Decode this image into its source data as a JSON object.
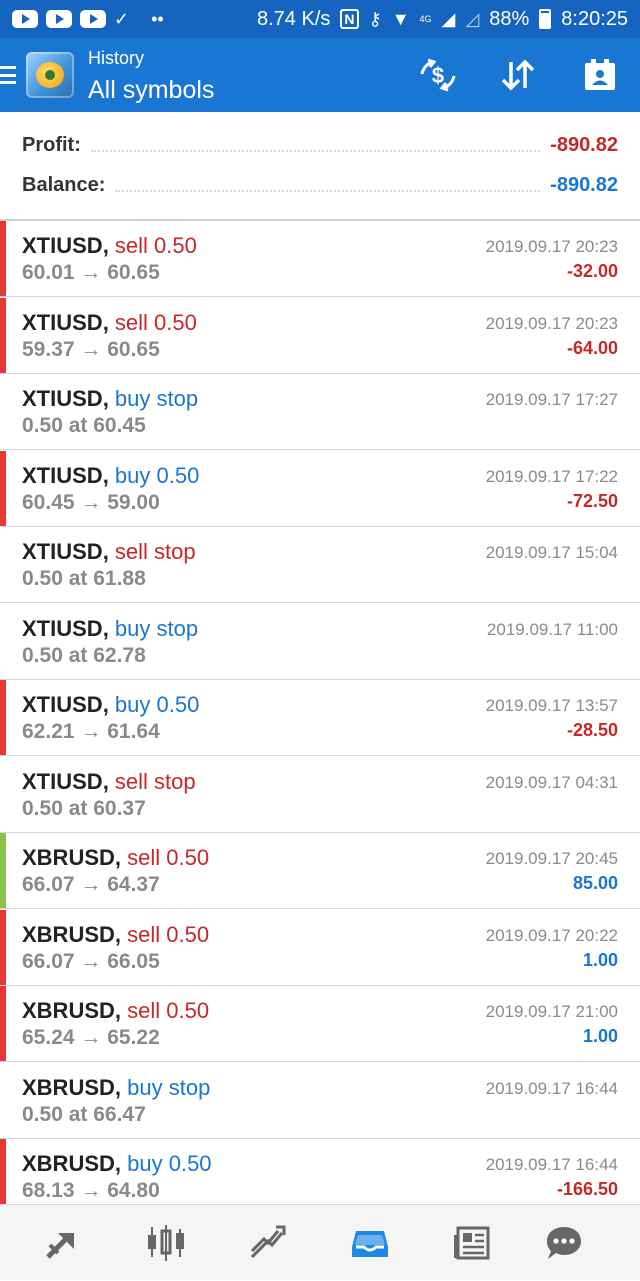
{
  "status_bar": {
    "network_speed": "8.74 K/s",
    "battery": "88%",
    "clock": "8:20:25",
    "signal_label": "4G"
  },
  "app_bar": {
    "subtitle": "History",
    "title": "All symbols"
  },
  "summary": {
    "profit_label": "Profit:",
    "profit_value": "-890.82",
    "balance_label": "Balance:",
    "balance_value": "-890.82"
  },
  "colors": {
    "accent": "#1976d2",
    "status_bar": "#1565c0",
    "loss": "#c62828",
    "gain": "#1976d2",
    "loss_bar": "#e53935",
    "gain_bar": "#8bc34a"
  },
  "trades": [
    {
      "symbol": "XTIUSD",
      "action": "sell 0.50",
      "action_type": "sell",
      "detail": "60.01 → 60.65",
      "time": "2019.09.17 20:23",
      "profit": "-32.00",
      "result": "loss"
    },
    {
      "symbol": "XTIUSD",
      "action": "sell 0.50",
      "action_type": "sell",
      "detail": "59.37 → 60.65",
      "time": "2019.09.17 20:23",
      "profit": "-64.00",
      "result": "loss"
    },
    {
      "symbol": "XTIUSD",
      "action": "buy stop",
      "action_type": "buy",
      "detail": "0.50 at 60.45",
      "time": "2019.09.17 17:27",
      "profit": "",
      "result": "none"
    },
    {
      "symbol": "XTIUSD",
      "action": "buy 0.50",
      "action_type": "buy",
      "detail": "60.45 → 59.00",
      "time": "2019.09.17 17:22",
      "profit": "-72.50",
      "result": "loss"
    },
    {
      "symbol": "XTIUSD",
      "action": "sell stop",
      "action_type": "sell",
      "detail": "0.50 at 61.88",
      "time": "2019.09.17 15:04",
      "profit": "",
      "result": "none"
    },
    {
      "symbol": "XTIUSD",
      "action": "buy stop",
      "action_type": "buy",
      "detail": "0.50 at 62.78",
      "time": "2019.09.17 11:00",
      "profit": "",
      "result": "none"
    },
    {
      "symbol": "XTIUSD",
      "action": "buy 0.50",
      "action_type": "buy",
      "detail": "62.21 → 61.64",
      "time": "2019.09.17 13:57",
      "profit": "-28.50",
      "result": "loss"
    },
    {
      "symbol": "XTIUSD",
      "action": "sell stop",
      "action_type": "sell",
      "detail": "0.50 at 60.37",
      "time": "2019.09.17 04:31",
      "profit": "",
      "result": "none"
    },
    {
      "symbol": "XBRUSD",
      "action": "sell 0.50",
      "action_type": "sell",
      "detail": "66.07 → 64.37",
      "time": "2019.09.17 20:45",
      "profit": "85.00",
      "result": "gain"
    },
    {
      "symbol": "XBRUSD",
      "action": "sell 0.50",
      "action_type": "sell",
      "detail": "66.07 → 66.05",
      "time": "2019.09.17 20:22",
      "profit": "1.00",
      "result": "small-gain"
    },
    {
      "symbol": "XBRUSD",
      "action": "sell 0.50",
      "action_type": "sell",
      "detail": "65.24 → 65.22",
      "time": "2019.09.17 21:00",
      "profit": "1.00",
      "result": "small-gain"
    },
    {
      "symbol": "XBRUSD",
      "action": "buy stop",
      "action_type": "buy",
      "detail": "0.50 at 66.47",
      "time": "2019.09.17 16:44",
      "profit": "",
      "result": "none"
    },
    {
      "symbol": "XBRUSD",
      "action": "buy 0.50",
      "action_type": "buy",
      "detail": "68.13 → 64.80",
      "time": "2019.09.17 16:44",
      "profit": "-166.50",
      "result": "loss"
    }
  ],
  "toolbar_icons": [
    "currency-exchange-icon",
    "sort-icon",
    "calendar-icon"
  ],
  "bottom_nav": [
    {
      "icon": "quotes-icon",
      "active": false
    },
    {
      "icon": "chart-icon",
      "active": false
    },
    {
      "icon": "trade-icon",
      "active": false
    },
    {
      "icon": "history-icon",
      "active": true
    },
    {
      "icon": "news-icon",
      "active": false
    },
    {
      "icon": "chat-icon",
      "active": false
    }
  ]
}
